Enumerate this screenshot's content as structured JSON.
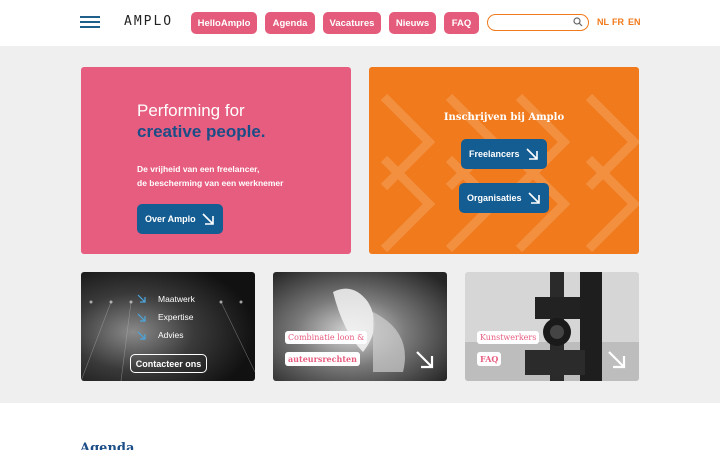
{
  "header": {
    "logo": "AMPLO",
    "nav": [
      "HelloAmplo",
      "Agenda",
      "Vacatures",
      "Nieuws",
      "FAQ"
    ],
    "search": {
      "value": "",
      "placeholder": ""
    },
    "languages": [
      "NL",
      "FR",
      "EN"
    ]
  },
  "hero_left": {
    "title_line1": "Performing for",
    "title_line2": "creative people.",
    "sub_line1": "De vrijheid van een freelancer,",
    "sub_line2": "de bescherming van een werknemer",
    "button": "Over Amplo"
  },
  "hero_right": {
    "title": "Inschrijven bij Amplo",
    "button1": "Freelancers",
    "button2": "Organisaties"
  },
  "tiles": {
    "t1": {
      "items": [
        "Maatwerk",
        "Expertise",
        "Advies"
      ],
      "button": "Contacteer ons"
    },
    "t2": {
      "label1": "Combinatie loon &",
      "label2": "auteursrechten"
    },
    "t3": {
      "label1": "Kunstwerkers",
      "label2": "FAQ"
    }
  },
  "agenda_heading": "Agenda",
  "colors": {
    "pink": "#e75d7f",
    "orange": "#f07a1c",
    "blue": "#145d92",
    "navy": "#1b4d86"
  }
}
